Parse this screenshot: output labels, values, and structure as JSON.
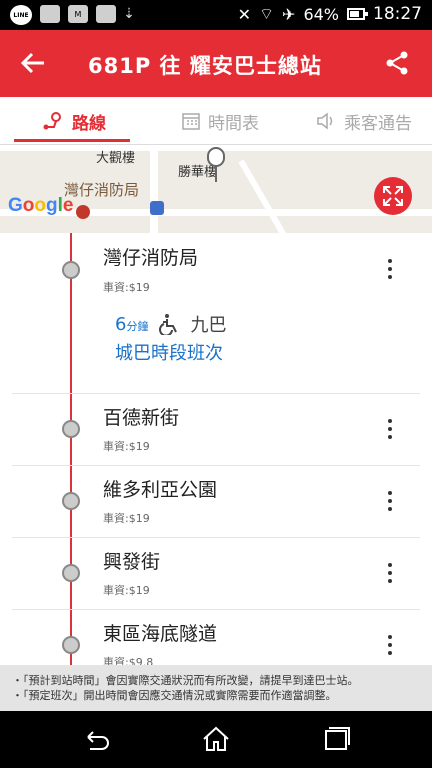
{
  "status_bar": {
    "battery": "64%",
    "time": "18:27",
    "line_label": "LINE"
  },
  "header": {
    "title": "681P 往 耀安巴士總站"
  },
  "tabs": [
    {
      "label": "路線",
      "icon": "route-icon",
      "active": true
    },
    {
      "label": "時間表",
      "icon": "calendar-icon",
      "active": false
    },
    {
      "label": "乘客通告",
      "icon": "speaker-icon",
      "active": false
    }
  ],
  "map": {
    "labels": [
      "大觀樓",
      "勝華樓",
      "灣仔消防局"
    ],
    "attribution": "Google"
  },
  "stops": [
    {
      "name": "灣仔消防局",
      "fare": "車資:$19"
    },
    {
      "name": "百德新街",
      "fare": "車資:$19"
    },
    {
      "name": "維多利亞公園",
      "fare": "車資:$19"
    },
    {
      "name": "興發街",
      "fare": "車資:$19"
    },
    {
      "name": "東區海底隧道",
      "fare": "車資:$9.8"
    }
  ],
  "eta": {
    "minutes": "6",
    "unit": "分鐘",
    "operator": "九巴",
    "note": "城巴時段班次"
  },
  "notice": {
    "line1": "・「預計到站時間」會因實際交通狀況而有所改變，請提早到達巴士站。",
    "line2": "・「預定班次」開出時間會因應交通情況或實際需要而作適當調整。"
  },
  "colors": {
    "brand": "#e42d35",
    "link": "#1a73c9"
  }
}
